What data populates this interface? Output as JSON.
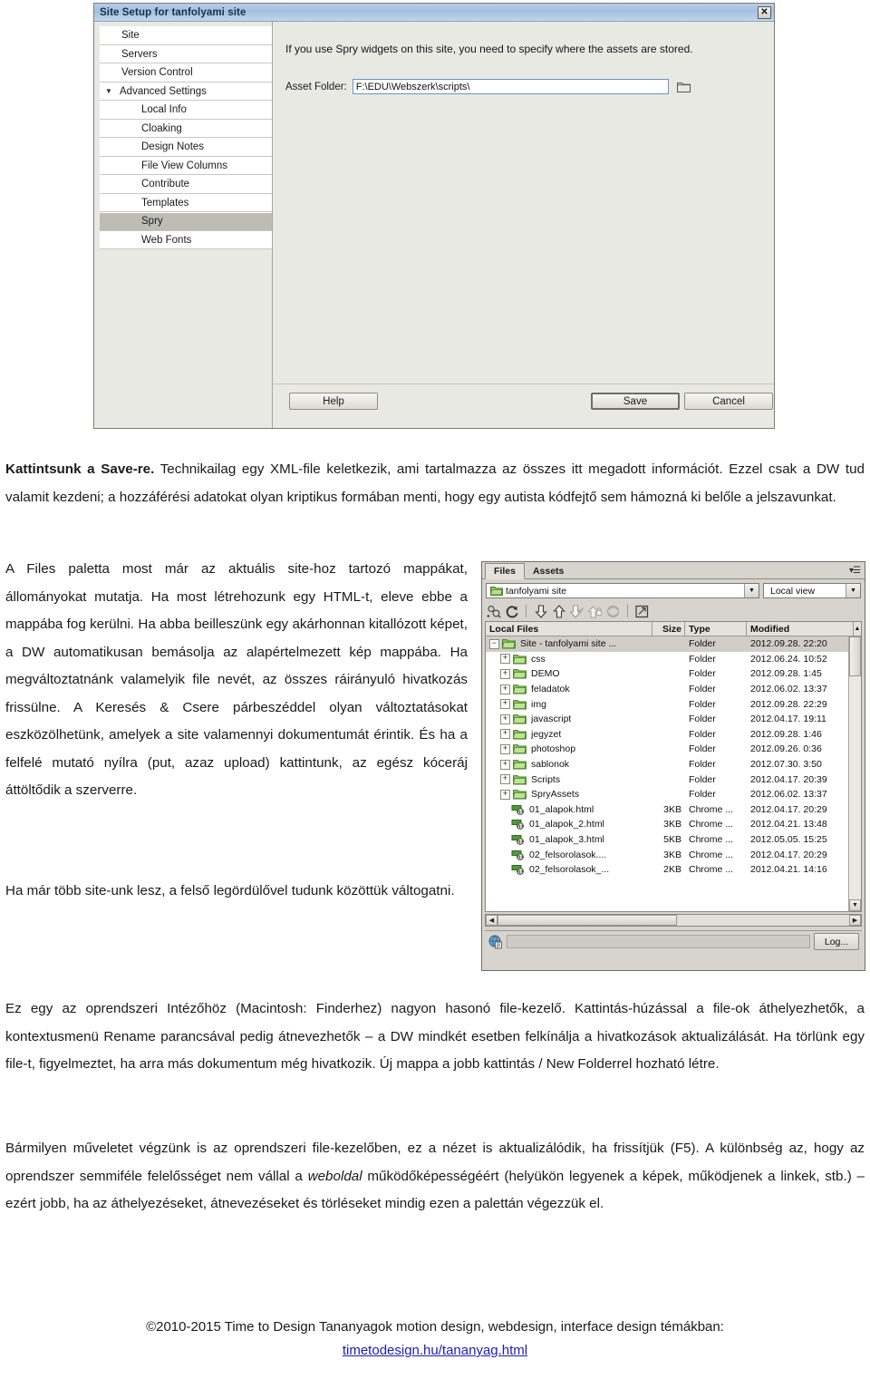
{
  "dialog": {
    "title": "Site Setup for tanfolyami site",
    "close_label": "✕",
    "nav_items": [
      {
        "label": "Site",
        "indent": 0,
        "caret": "",
        "selected": false
      },
      {
        "label": "Servers",
        "indent": 0,
        "caret": "",
        "selected": false
      },
      {
        "label": "Version Control",
        "indent": 0,
        "caret": "",
        "selected": false
      },
      {
        "label": "Advanced Settings",
        "indent": 0,
        "caret": "▼",
        "selected": false
      },
      {
        "label": "Local Info",
        "indent": 1,
        "caret": "",
        "selected": false
      },
      {
        "label": "Cloaking",
        "indent": 1,
        "caret": "",
        "selected": false
      },
      {
        "label": "Design Notes",
        "indent": 1,
        "caret": "",
        "selected": false
      },
      {
        "label": "File View Columns",
        "indent": 1,
        "caret": "",
        "selected": false
      },
      {
        "label": "Contribute",
        "indent": 1,
        "caret": "",
        "selected": false
      },
      {
        "label": "Templates",
        "indent": 1,
        "caret": "",
        "selected": false
      },
      {
        "label": "Spry",
        "indent": 1,
        "caret": "",
        "selected": true
      },
      {
        "label": "Web Fonts",
        "indent": 1,
        "caret": "",
        "selected": false
      }
    ],
    "help_text": "If you use Spry widgets on this site, you need to specify where the assets are stored.",
    "asset_label": "Asset Folder:",
    "asset_value": "F:\\EDU\\Webszerk\\scripts\\",
    "asset_placeholder": "",
    "buttons": {
      "help": "Help",
      "save": "Save",
      "cancel": "Cancel"
    }
  },
  "body": {
    "p1_html": "<b>Kattintsunk a Save-re.</b> Technikailag egy XML-file keletkezik, ami tartalmazza az összes itt megadott információt. Ezzel csak a DW tud valamit kezdeni; a hozzáférési adatokat olyan kriptikus formában menti, hogy egy autista kódfejtő sem hámozná ki belőle a jelszavunkat.",
    "p2": "A Files paletta most már az aktuális site-hoz tartozó mappákat, állományokat mutatja. Ha most létrehozunk egy HTML-t, eleve ebbe a mappába fog kerülni. Ha abba beilleszünk egy akárhonnan kitallózott képet, a DW automatikusan bemásolja az alapértelmezett kép mappába. Ha megváltoztatnánk valamelyik file nevét, az összes ráirányuló hivatkozás frissülne. A Keresés & Csere párbeszéddel olyan változtatásokat eszközölhetünk, amelyek a site valamennyi dokumentumát érintik. És ha a felfelé mutató nyílra (put, azaz upload) kattintunk, az egész kóceráj áttöltődik a szerverre.",
    "p3": "Ha már több site-unk lesz, a felső legördülővel tudunk közöttük váltogatni.",
    "p4": "Ez egy az oprendszeri Intézőhöz (Macintosh: Finderhez) nagyon hasonó file-kezelő. Kattintás-húzással a file-ok áthelyezhetők, a kontextusmenü Rename parancsával pedig átnevezhetők – a DW mindkét esetben felkínálja a hivatkozások aktualizálását. Ha törlünk egy file-t, figyelmeztet, ha arra más dokumentum még hivatkozik. Új mappa a jobb kattintás / New Folderrel hozható létre.",
    "p5_html": "Bármilyen műveletet végzünk is az oprendszeri file-kezelőben, ez a nézet is aktualizálódik, ha frissítjük (F5). A különbség az, hogy az oprendszer semmiféle felelősséget nem vállal a <i>weboldal</i> működőképességéért (helyükön legyenek a képek, működjenek a linkek, stb.) – ezért jobb, ha az áthelyezéseket, átnevezéseket és törléseket mindig ezen a palettán végezzük el."
  },
  "files_panel": {
    "tabs": [
      {
        "label": "Files",
        "active": true
      },
      {
        "label": "Assets",
        "active": false
      }
    ],
    "panel_menu_icon": "menu-icon",
    "site_combo_value": "tanfolyami site",
    "view_combo_value": "Local view",
    "toolbar_icons": [
      "connect-to-remote-host-icon",
      "refresh-icon",
      "get-files-icon",
      "put-files-icon",
      "check-out-icon",
      "check-in-icon",
      "synchronize-icon",
      "expand-collapse-icon"
    ],
    "columns": [
      "Local Files",
      "Size",
      "Type",
      "Modified"
    ],
    "sort_arrow": "▲",
    "rows": [
      {
        "name": "Site - tanfolyami site ...",
        "size": "",
        "type": "Folder",
        "modified": "2012.09.28. 22:20",
        "indent": 0,
        "expander": "−",
        "kind": "folder",
        "selected": true
      },
      {
        "name": "css",
        "size": "",
        "type": "Folder",
        "modified": "2012.06.24. 10:52",
        "indent": 1,
        "expander": "+",
        "kind": "folder",
        "selected": false
      },
      {
        "name": "DEMO",
        "size": "",
        "type": "Folder",
        "modified": "2012.09.28. 1:45",
        "indent": 1,
        "expander": "+",
        "kind": "folder",
        "selected": false
      },
      {
        "name": "feladatok",
        "size": "",
        "type": "Folder",
        "modified": "2012.06.02. 13:37",
        "indent": 1,
        "expander": "+",
        "kind": "folder",
        "selected": false
      },
      {
        "name": "img",
        "size": "",
        "type": "Folder",
        "modified": "2012.09.28. 22:29",
        "indent": 1,
        "expander": "+",
        "kind": "folder",
        "selected": false
      },
      {
        "name": "javascript",
        "size": "",
        "type": "Folder",
        "modified": "2012.04.17. 19:11",
        "indent": 1,
        "expander": "+",
        "kind": "folder",
        "selected": false
      },
      {
        "name": "jegyzet",
        "size": "",
        "type": "Folder",
        "modified": "2012.09.28. 1:46",
        "indent": 1,
        "expander": "+",
        "kind": "folder",
        "selected": false
      },
      {
        "name": "photoshop",
        "size": "",
        "type": "Folder",
        "modified": "2012.09.26. 0:36",
        "indent": 1,
        "expander": "+",
        "kind": "folder",
        "selected": false
      },
      {
        "name": "sablonok",
        "size": "",
        "type": "Folder",
        "modified": "2012.07.30. 3:50",
        "indent": 1,
        "expander": "+",
        "kind": "folder",
        "selected": false
      },
      {
        "name": "Scripts",
        "size": "",
        "type": "Folder",
        "modified": "2012.04.17. 20:39",
        "indent": 1,
        "expander": "+",
        "kind": "folder",
        "selected": false
      },
      {
        "name": "SpryAssets",
        "size": "",
        "type": "Folder",
        "modified": "2012.06.02. 13:37",
        "indent": 1,
        "expander": "+",
        "kind": "folder",
        "selected": false
      },
      {
        "name": "01_alapok.html",
        "size": "3KB",
        "type": "Chrome ...",
        "modified": "2012.04.17. 20:29",
        "indent": 1,
        "expander": "",
        "kind": "html",
        "selected": false
      },
      {
        "name": "01_alapok_2.html",
        "size": "3KB",
        "type": "Chrome ...",
        "modified": "2012.04.21. 13:48",
        "indent": 1,
        "expander": "",
        "kind": "html",
        "selected": false
      },
      {
        "name": "01_alapok_3.html",
        "size": "5KB",
        "type": "Chrome ...",
        "modified": "2012.05.05. 15:25",
        "indent": 1,
        "expander": "",
        "kind": "html",
        "selected": false
      },
      {
        "name": "02_felsorolasok....",
        "size": "3KB",
        "type": "Chrome ...",
        "modified": "2012.04.17. 20:29",
        "indent": 1,
        "expander": "",
        "kind": "html",
        "selected": false
      },
      {
        "name": "02_felsorolasok_...",
        "size": "2KB",
        "type": "Chrome ...",
        "modified": "2012.04.21. 14:16",
        "indent": 1,
        "expander": "",
        "kind": "html",
        "selected": false
      }
    ],
    "log_button": "Log...",
    "scroll_left_arrow": "◀",
    "scroll_right_arrow": "▶",
    "scroll_down_arrow": "▼"
  },
  "footer": {
    "text": "©2010-2015 Time to Design Tananyagok motion design, webdesign, interface design témákban:",
    "link": "timetodesign.hu/tananyag.html"
  },
  "colors": {
    "title_accent": "#16324f",
    "link": "#1b1bbf",
    "folder_green": "#7bbd4a",
    "selection_gray": "#bdbdb6"
  }
}
